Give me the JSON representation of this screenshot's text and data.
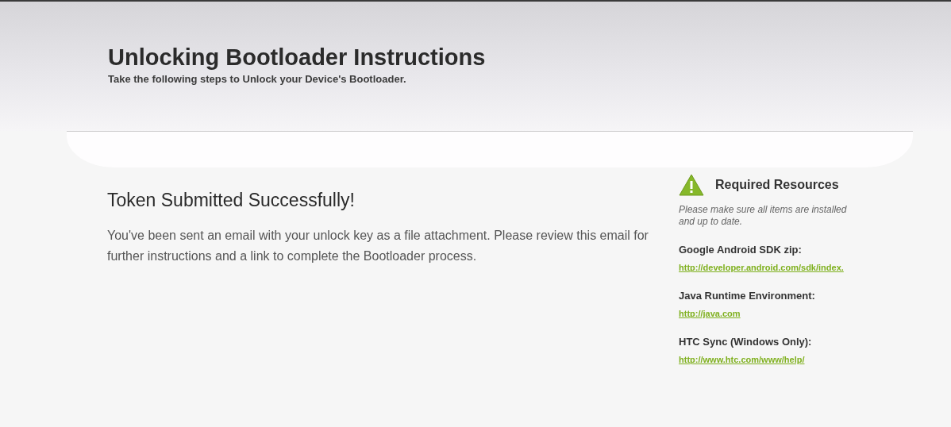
{
  "header": {
    "title": "Unlocking Bootloader Instructions",
    "subtitle": "Take the following steps to Unlock your Device's Bootloader."
  },
  "main": {
    "heading": "Token Submitted Successfully!",
    "body": "You've been sent an email with your unlock key as a file attachment. Please review this email for further instructions and a link to complete the Bootloader process."
  },
  "sidebar": {
    "title": "Required Resources",
    "note": "Please make sure all items are installed and up to date.",
    "resources": [
      {
        "name": "Google Android SDK zip:",
        "link": "http://developer.android.com/sdk/index."
      },
      {
        "name": "Java Runtime Environment:",
        "link": "http://java.com"
      },
      {
        "name": "HTC Sync (Windows Only):",
        "link": "http://www.htc.com/www/help/"
      }
    ]
  }
}
